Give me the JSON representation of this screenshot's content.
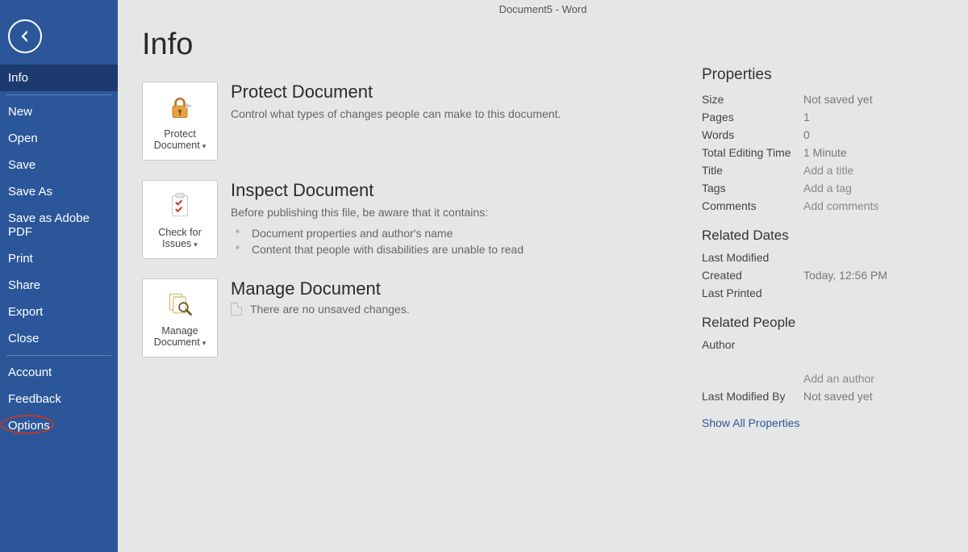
{
  "titlebar": "Document5  -  Word",
  "sidebar": {
    "items": [
      {
        "label": "Info",
        "selected": true
      },
      {
        "label": "New"
      },
      {
        "label": "Open"
      },
      {
        "label": "Save"
      },
      {
        "label": "Save As"
      },
      {
        "label": "Save as Adobe PDF"
      },
      {
        "label": "Print"
      },
      {
        "label": "Share"
      },
      {
        "label": "Export"
      },
      {
        "label": "Close"
      }
    ],
    "footer": [
      {
        "label": "Account"
      },
      {
        "label": "Feedback"
      },
      {
        "label": "Options",
        "highlight": true
      }
    ]
  },
  "pageTitle": "Info",
  "actions": {
    "protect": {
      "btn": "Protect Document",
      "heading": "Protect Document",
      "desc": "Control what types of changes people can make to this document."
    },
    "inspect": {
      "btn": "Check for Issues",
      "heading": "Inspect Document",
      "desc": "Before publishing this file, be aware that it contains:",
      "bullets": [
        "Document properties and author's name",
        "Content that people with disabilities are unable to read"
      ]
    },
    "manage": {
      "btn": "Manage Document",
      "heading": "Manage Document",
      "desc": "There are no unsaved changes."
    }
  },
  "properties": {
    "heading": "Properties",
    "rows": {
      "size_k": "Size",
      "size_v": "Not saved yet",
      "pages_k": "Pages",
      "pages_v": "1",
      "words_k": "Words",
      "words_v": "0",
      "edit_k": "Total Editing Time",
      "edit_v": "1 Minute",
      "title_k": "Title",
      "title_v": "Add a title",
      "tags_k": "Tags",
      "tags_v": "Add a tag",
      "comments_k": "Comments",
      "comments_v": "Add comments"
    },
    "dates_h": "Related Dates",
    "dates": {
      "lm_k": "Last Modified",
      "lm_v": "",
      "cr_k": "Created",
      "cr_v": "Today, 12:56 PM",
      "lp_k": "Last Printed",
      "lp_v": ""
    },
    "people_h": "Related People",
    "people": {
      "author_k": "Author",
      "addauthor_v": "Add an author",
      "lmb_k": "Last Modified By",
      "lmb_v": "Not saved yet"
    },
    "showAll": "Show All Properties"
  }
}
